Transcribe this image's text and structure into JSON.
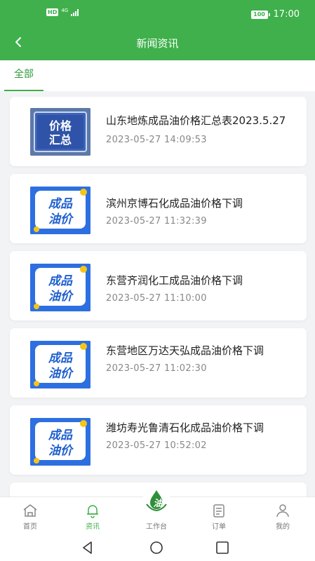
{
  "status_bar": {
    "hd": "HD",
    "network": "4G",
    "battery": "100",
    "time": "17:00"
  },
  "nav": {
    "title": "新闻资讯"
  },
  "tabs": [
    {
      "label": "全部",
      "active": true
    }
  ],
  "news": [
    {
      "title": "山东地炼成品油价格汇总表2023.5.27",
      "date": "2023-05-27 14:09:53",
      "thumb_text": [
        "价格",
        "汇总"
      ],
      "thumb_type": "summary"
    },
    {
      "title": "滨州京博石化成品油价格下调",
      "date": "2023-05-27 11:32:39",
      "thumb_text": [
        "成品",
        "油价"
      ],
      "thumb_type": "oil"
    },
    {
      "title": "东营齐润化工成品油价格下调",
      "date": "2023-05-27 11:10:00",
      "thumb_text": [
        "成品",
        "油价"
      ],
      "thumb_type": "oil"
    },
    {
      "title": "东营地区万达天弘成品油价格下调",
      "date": "2023-05-27 11:02:30",
      "thumb_text": [
        "成品",
        "油价"
      ],
      "thumb_type": "oil"
    },
    {
      "title": "潍坊寿光鲁清石化成品油价格下调",
      "date": "2023-05-27 10:52:02",
      "thumb_text": [
        "成品",
        "油价"
      ],
      "thumb_type": "oil"
    }
  ],
  "tabbar": {
    "items": [
      {
        "label": "首页",
        "icon": "home-icon"
      },
      {
        "label": "资讯",
        "icon": "bell-icon",
        "active": true
      },
      {
        "label": "工作台",
        "icon": "oil-logo-icon",
        "logo_text": "油"
      },
      {
        "label": "订单",
        "icon": "order-icon"
      },
      {
        "label": "我的",
        "icon": "user-icon"
      }
    ]
  },
  "colors": {
    "primary": "#3fb04b",
    "title_text": "#222222",
    "date_text": "#888888"
  }
}
